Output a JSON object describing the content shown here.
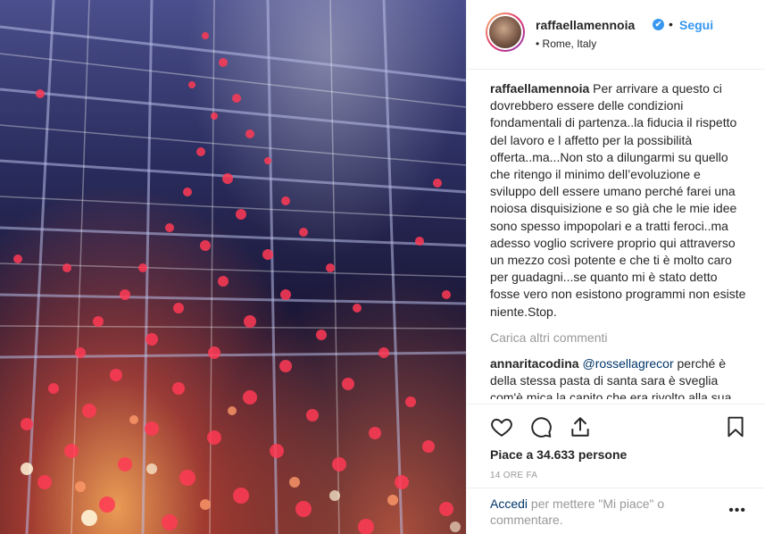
{
  "post": {
    "username": "raffaellamennoia",
    "verified_badge": "✔",
    "separator": "•",
    "follow_label": "Segui",
    "location": "• Rome, Italy"
  },
  "caption": {
    "username": "raffaellamennoia",
    "text": "Per arrivare a questo ci dovrebbero essere delle condizioni fondamentali di partenza..la fiducia il rispetto del lavoro e l affetto per la possibilità offerta..ma...Non sto a dilungarmi su quello che ritengo il minimo dell’evoluzione e sviluppo dell essere umano perché farei una noiosa disquisizione e so già che le mie idee sono spesso impopolari e a tratti feroci..ma adesso voglio scrivere proprio qui attraverso un mezzo così potente e che ti è molto caro per guadagni...se quanto mi è stato detto fosse vero non esistono programmi non esiste niente.Stop."
  },
  "load_more_label": "Carica altri commenti",
  "comment": {
    "username": "annaritacodina",
    "mention": "@rossellagrecor",
    "text": "perché è della stessa pasta di santa sara è sveglia com'è mica la capito che era rivolto alla sua"
  },
  "actions": {
    "icons": [
      "heart-icon",
      "comment-icon",
      "share-icon",
      "bookmark-icon"
    ]
  },
  "likes_text": "Piace a 34.633 persone",
  "timestamp": "14 ORE FA",
  "login": {
    "link_label": "Accedi",
    "rest_text": "per mettere \"Mi piace\" o commentare."
  },
  "more_label": "•••"
}
